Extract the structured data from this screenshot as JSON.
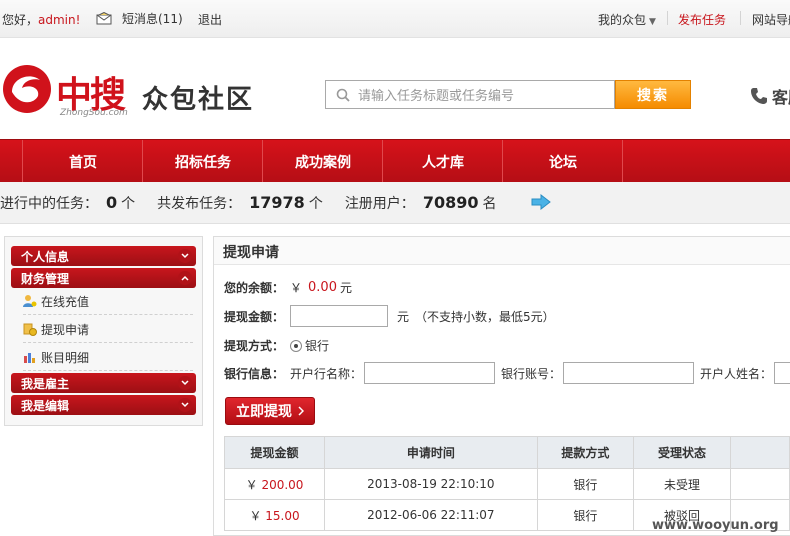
{
  "topbar": {
    "greeting": "您好，",
    "username": "admin",
    "exclaim": "!",
    "messages_label": "短消息(11)",
    "logout": "退出",
    "my_package": "我的众包",
    "publish_task": "发布任务",
    "site_nav": "网站导航"
  },
  "header": {
    "logo_cn": "中搜",
    "logo_en": "ZhongSou.com",
    "subtitle": "众包社区",
    "search_placeholder": "请输入任务标题或任务编号",
    "search_button": "搜索",
    "hotline": "客服"
  },
  "nav": [
    "首页",
    "招标任务",
    "成功案例",
    "人才库",
    "论坛"
  ],
  "stats": {
    "in_progress_label": "进行中的任务：",
    "in_progress_value": "0",
    "in_progress_unit": "个",
    "total_label": "共发布任务：",
    "total_value": "17978",
    "total_unit": "个",
    "users_label": "注册用户：",
    "users_value": "70890",
    "users_unit": "名"
  },
  "sidebar": {
    "personal": "个人信息",
    "finance": "财务管理",
    "recharge": "在线充值",
    "withdraw": "提现申请",
    "ledger": "账目明细",
    "employer": "我是雇主",
    "editor": "我是编辑"
  },
  "content": {
    "title": "提现申请",
    "balance_label": "您的余额：",
    "balance_currency": "￥",
    "balance_value": "0.00",
    "balance_unit": "元",
    "amount_label": "提现金额：",
    "amount_unit": "元",
    "amount_note": "（不支持小数，最低5元）",
    "method_label": "提现方式：",
    "method_option": "银行",
    "bank_label": "银行信息：",
    "bank_name_label": "开户行名称：",
    "bank_account_label": "银行账号：",
    "holder_label": "开户人姓名：",
    "submit": "立即提现"
  },
  "history": {
    "headers": [
      "提现金额",
      "申请时间",
      "提款方式",
      "受理状态"
    ],
    "rows": [
      {
        "currency": "￥",
        "amount": "200.00",
        "time": "2013-08-19 22:10:10",
        "method": "银行",
        "status": "未受理"
      },
      {
        "currency": "￥",
        "amount": "15.00",
        "time": "2012-06-06 22:11:07",
        "method": "银行",
        "status": "被驳回"
      }
    ]
  },
  "watermark": "www.wooyun.org",
  "colors": {
    "brand_red": "#c8161d",
    "search_orange": "#f58b00"
  }
}
